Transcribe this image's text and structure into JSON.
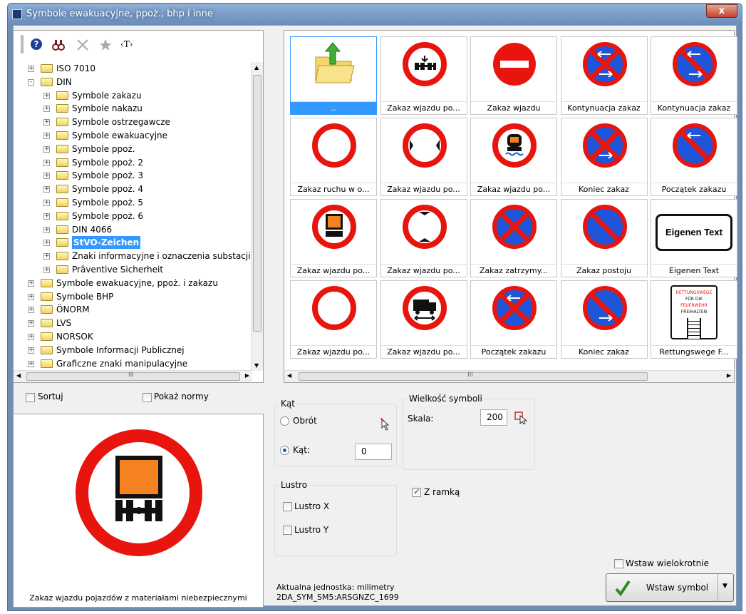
{
  "window": {
    "title": "Symbole ewakuacyjne, ppoż., bhp i inne",
    "close_label": "x"
  },
  "toolbar": {
    "help_icon": "?",
    "tag_label": "‹T›"
  },
  "tree": {
    "items": [
      {
        "label": "ISO 7010",
        "level": 0,
        "sign": "+"
      },
      {
        "label": "DIN",
        "level": 0,
        "sign": "-"
      },
      {
        "label": "Symbole zakazu",
        "level": 1,
        "sign": "+"
      },
      {
        "label": "Symbole nakazu",
        "level": 1,
        "sign": "+"
      },
      {
        "label": "Symbole ostrzegawcze",
        "level": 1,
        "sign": "+"
      },
      {
        "label": "Symbole ewakuacyjne",
        "level": 1,
        "sign": "+"
      },
      {
        "label": "Symbole ppoż.",
        "level": 1,
        "sign": "+"
      },
      {
        "label": "Symbole ppoż. 2",
        "level": 1,
        "sign": "+"
      },
      {
        "label": "Symbole ppoż. 3",
        "level": 1,
        "sign": "+"
      },
      {
        "label": "Symbole ppoż. 4",
        "level": 1,
        "sign": "+"
      },
      {
        "label": "Symbole ppoż. 5",
        "level": 1,
        "sign": "+"
      },
      {
        "label": "Symbole ppoż. 6",
        "level": 1,
        "sign": "+"
      },
      {
        "label": "DIN 4066",
        "level": 1,
        "sign": "+"
      },
      {
        "label": "StVO-Zeichen",
        "level": 1,
        "sign": "+",
        "selected": true
      },
      {
        "label": "Znaki informacyjne i oznaczenia substacji cher",
        "level": 1,
        "sign": "+"
      },
      {
        "label": "Präventive Sicherheit",
        "level": 1,
        "sign": "+"
      },
      {
        "label": "Symbole ewakuacyjne, ppoż. i zakazu",
        "level": 0,
        "sign": "+"
      },
      {
        "label": "Symbole BHP",
        "level": 0,
        "sign": "+"
      },
      {
        "label": "ÖNORM",
        "level": 0,
        "sign": "+"
      },
      {
        "label": "LVS",
        "level": 0,
        "sign": "+"
      },
      {
        "label": "NORSOK",
        "level": 0,
        "sign": "+"
      },
      {
        "label": "Symbole Informacji Publicznej",
        "level": 0,
        "sign": "+"
      },
      {
        "label": "Graficzne znaki manipulacyjne",
        "level": 0,
        "sign": "+"
      }
    ],
    "hscroll_label": "III"
  },
  "grid": {
    "cells": [
      {
        "caption": "..",
        "icon": "folder-up"
      },
      {
        "caption": "Zakaz wjazdu po...",
        "icon": "no-entry-vehicle"
      },
      {
        "caption": "Zakaz wjazdu",
        "icon": "no-entry"
      },
      {
        "caption": "Kontynuacja zakaz",
        "icon": "no-parking-cross-arrows"
      },
      {
        "caption": "Kontynuacja zakaz",
        "icon": "no-parking-diag-arrows"
      },
      {
        "caption": "Zakaz ruchu w o...",
        "icon": "empty-circle"
      },
      {
        "caption": "Zakaz wjazdu po...",
        "icon": "width-limit"
      },
      {
        "caption": "Zakaz wjazdu po...",
        "icon": "water-pollutant"
      },
      {
        "caption": "Koniec zakaz",
        "icon": "no-stopping-end"
      },
      {
        "caption": "Początek zakazu",
        "icon": "no-parking-start"
      },
      {
        "caption": "Zakaz wjazdu po...",
        "icon": "hazardous-goods"
      },
      {
        "caption": "Zakaz wjazdu po...",
        "icon": "height-limit"
      },
      {
        "caption": "Zakaz zatrzymy...",
        "icon": "no-stopping"
      },
      {
        "caption": "Zakaz postoju",
        "icon": "no-parking"
      },
      {
        "caption": "Eigenen Text",
        "icon": "text-sign",
        "sign_text": "Eigenen Text"
      },
      {
        "caption": "Zakaz wjazdu po...",
        "icon": "empty-circle"
      },
      {
        "caption": "Zakaz wjazdu po...",
        "icon": "truck-overtake"
      },
      {
        "caption": "Początek zakazu",
        "icon": "no-stopping-start"
      },
      {
        "caption": "Koniec zakaz",
        "icon": "no-parking-end"
      },
      {
        "caption": "Rettungswege F...",
        "icon": "rescue-route",
        "sign_lines": [
          "RETTUNGSWEGE",
          "FÜR DIE",
          "FEUERWEHR",
          "FREIHALTEN"
        ]
      }
    ],
    "hscroll_label": "III"
  },
  "options": {
    "sort_label": "Sortuj",
    "show_norms_label": "Pokaż normy",
    "sort_checked": false,
    "show_norms_checked": false
  },
  "angle": {
    "group_label": "Kąt",
    "rotate_label": "Obrót",
    "angle_label": "Kąt:",
    "angle_value": "0",
    "selected": "angle"
  },
  "size": {
    "group_label": "Wielkość symboli",
    "scale_label": "Skala:",
    "scale_value": "200"
  },
  "mirror": {
    "group_label": "Lustro",
    "x_label": "Lustro X",
    "y_label": "Lustro Y",
    "x_checked": false,
    "y_checked": false
  },
  "frame": {
    "label": "Z ramką",
    "checked": true
  },
  "preview": {
    "caption": "Zakaz wjazdu pojazdów z materiałami niebezpiecznymi"
  },
  "unit": {
    "line1": "Aktualna jednostka: milimetry",
    "line2": "2DA_SYM_SM5:ARSGNZC_1699"
  },
  "insert": {
    "multi_label": "Wstaw wielokrotnie",
    "multi_checked": false,
    "button_label": "Wstaw symbol"
  },
  "colors": {
    "red": "#e8140e",
    "blue": "#1f55d8",
    "orange": "#f58220",
    "selection": "#3399ff"
  }
}
